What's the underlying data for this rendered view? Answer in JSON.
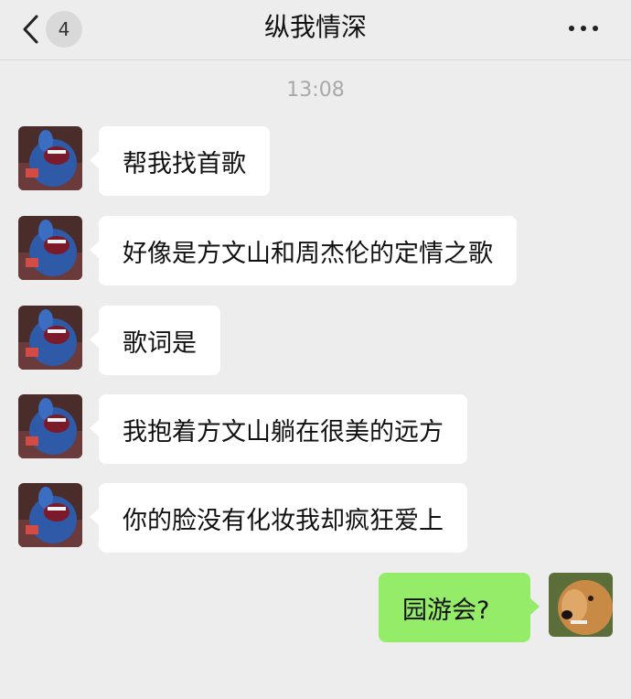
{
  "header": {
    "title": "纵我情深",
    "unread_count": "4"
  },
  "timestamp": "13:08",
  "messages": [
    {
      "sender": "other",
      "text": "帮我找首歌"
    },
    {
      "sender": "other",
      "text": "好像是方文山和周杰伦的定情之歌"
    },
    {
      "sender": "other",
      "text": "歌词是"
    },
    {
      "sender": "other",
      "text": "我抱着方文山躺在很美的远方"
    },
    {
      "sender": "other",
      "text": "你的脸没有化妆我却疯狂爱上"
    },
    {
      "sender": "me",
      "text": "园游会?"
    }
  ],
  "colors": {
    "background": "#ededed",
    "incoming_bubble": "#ffffff",
    "outgoing_bubble": "#95ec69"
  },
  "icons": {
    "back": "chevron-left-icon",
    "more": "more-dots-icon"
  }
}
